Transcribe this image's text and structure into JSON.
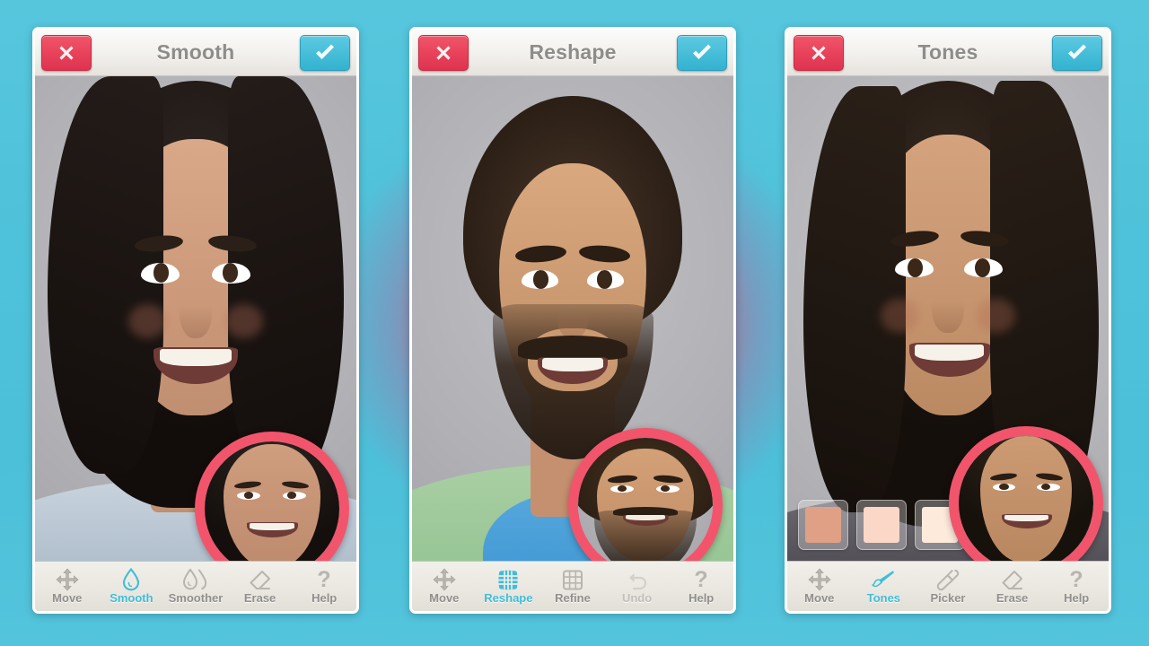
{
  "app": {
    "background_color": "#4ec2da",
    "glow_color": "#f43c58",
    "accent_color": "#3fbdd8",
    "cancel_color": "#e8415a",
    "loupe_ring_color": "#f2556b"
  },
  "panels": [
    {
      "id": "smooth",
      "title": "Smooth",
      "cancel_label": "close-icon",
      "confirm_label": "check-icon",
      "tools": [
        {
          "label": "Move",
          "icon": "move-icon",
          "state": "normal"
        },
        {
          "label": "Smooth",
          "icon": "droplet-icon",
          "state": "active"
        },
        {
          "label": "Smoother",
          "icon": "droplets-icon",
          "state": "normal"
        },
        {
          "label": "Erase",
          "icon": "eraser-icon",
          "state": "normal"
        },
        {
          "label": "Help",
          "icon": "question-icon",
          "state": "normal"
        }
      ],
      "swatches": []
    },
    {
      "id": "reshape",
      "title": "Reshape",
      "cancel_label": "close-icon",
      "confirm_label": "check-icon",
      "tools": [
        {
          "label": "Move",
          "icon": "move-icon",
          "state": "normal"
        },
        {
          "label": "Reshape",
          "icon": "mesh-icon",
          "state": "active"
        },
        {
          "label": "Refine",
          "icon": "grid-icon",
          "state": "normal"
        },
        {
          "label": "Undo",
          "icon": "undo-icon",
          "state": "disabled"
        },
        {
          "label": "Help",
          "icon": "question-icon",
          "state": "normal"
        }
      ],
      "swatches": []
    },
    {
      "id": "tones",
      "title": "Tones",
      "cancel_label": "close-icon",
      "confirm_label": "check-icon",
      "tools": [
        {
          "label": "Move",
          "icon": "move-icon",
          "state": "normal"
        },
        {
          "label": "Tones",
          "icon": "brush-icon",
          "state": "active"
        },
        {
          "label": "Picker",
          "icon": "eyedropper-icon",
          "state": "normal"
        },
        {
          "label": "Erase",
          "icon": "eraser-icon",
          "state": "normal"
        },
        {
          "label": "Help",
          "icon": "question-icon",
          "state": "normal"
        }
      ],
      "swatches": [
        {
          "name": "tone-swatch-1",
          "color": "#e0a086"
        },
        {
          "name": "tone-swatch-2",
          "color": "#fad7c6"
        },
        {
          "name": "tone-swatch-3",
          "color": "#fdeadb"
        }
      ]
    }
  ]
}
